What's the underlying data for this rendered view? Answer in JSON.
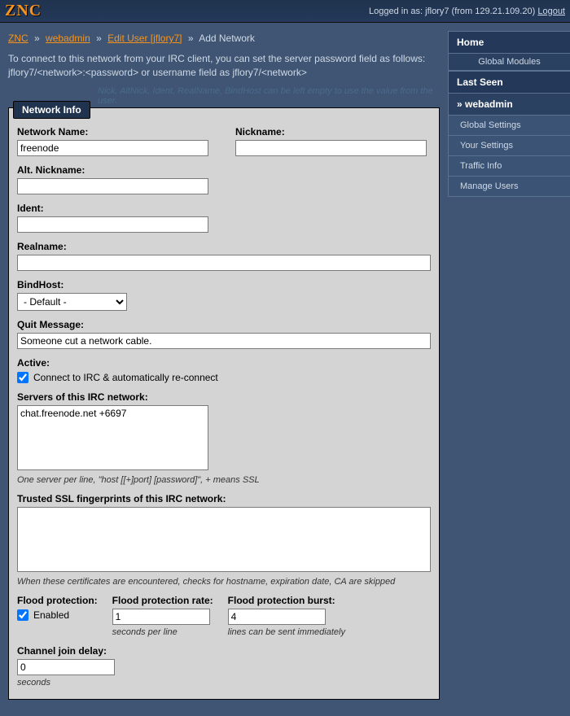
{
  "header": {
    "logo": "ZNC",
    "login_prefix": "Logged in as: ",
    "username": "jflory7",
    "from_prefix": " (from ",
    "ip": "129.21.109.20",
    "from_suffix": ") ",
    "logout": "Logout"
  },
  "breadcrumb": {
    "znc": "ZNC",
    "webadmin": "webadmin",
    "edit_user": "Edit User [jflory7]",
    "current": "Add Network"
  },
  "intro": "To connect to this network from your IRC client, you can set the server password field as follows: jflory7/<network>:<password> or username field as jflory7/<network>",
  "hint_top": "Nick, AltNick, Ident, RealName, BindHost can be left empty to use the value from the user.",
  "fieldset": {
    "legend": "Network Info"
  },
  "labels": {
    "network_name": "Network Name:",
    "nickname": "Nickname:",
    "alt_nick": "Alt. Nickname:",
    "ident": "Ident:",
    "realname": "Realname:",
    "bindhost": "BindHost:",
    "quit": "Quit Message:",
    "active": "Active:",
    "servers": "Servers of this IRC network:",
    "trusted": "Trusted SSL fingerprints of this IRC network:",
    "flood_prot": "Flood protection:",
    "flood_rate": "Flood protection rate:",
    "flood_burst": "Flood protection burst:",
    "chan_delay": "Channel join delay:"
  },
  "values": {
    "network_name": "freenode",
    "nickname": "",
    "alt_nick": "",
    "ident": "",
    "realname": "",
    "bindhost": "- Default -",
    "quit": "Someone cut a network cable.",
    "active_checked": true,
    "active_label": "Connect to IRC & automatically re-connect",
    "servers": "chat.freenode.net +6697",
    "trusted": "",
    "flood_enabled": true,
    "flood_enabled_label": "Enabled",
    "flood_rate": "1",
    "flood_burst": "4",
    "chan_delay": "0"
  },
  "hints": {
    "servers": "One server per line, \"host [[+]port] [password]\", + means SSL",
    "trusted": "When these certificates are encountered, checks for hostname, expiration date, CA are skipped",
    "flood_rate": "seconds per line",
    "flood_burst": "lines can be sent immediately",
    "chan_delay": "seconds"
  },
  "sidebar": {
    "home": "Home",
    "global_modules": "Global Modules",
    "last_seen": "Last Seen",
    "webadmin": "» webadmin",
    "items": [
      "Global Settings",
      "Your Settings",
      "Traffic Info",
      "Manage Users"
    ]
  }
}
